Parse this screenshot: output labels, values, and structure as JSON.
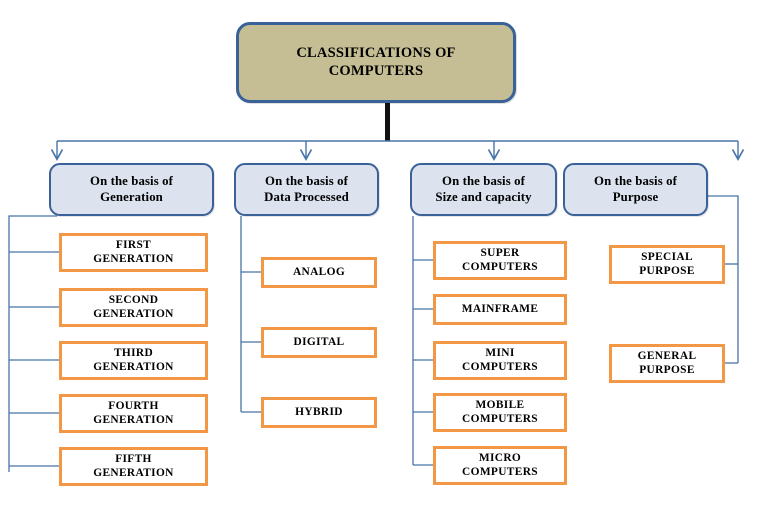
{
  "diagram": {
    "title": "CLASSIFICATIONS OF\nCOMPUTERS",
    "colors": {
      "root_fill": "#C5BE94",
      "branch_fill": "#DCE3EF",
      "leaf_fill": "#FFFFFF",
      "blue_border": "#3A6198",
      "orange_border": "#F19745",
      "connector_blue": "#4874A8",
      "trunk_black": "#111111"
    },
    "branches": [
      {
        "id": "generation",
        "label": "On the basis of\nGeneration",
        "leaves": [
          {
            "label": "FIRST\nGENERATION"
          },
          {
            "label": "SECOND\nGENERATION"
          },
          {
            "label": "THIRD\nGENERATION"
          },
          {
            "label": "FOURTH\nGENERATION"
          },
          {
            "label": "FIFTH\nGENERATION"
          }
        ]
      },
      {
        "id": "data-processed",
        "label": "On the basis of\nData Processed",
        "leaves": [
          {
            "label": "ANALOG"
          },
          {
            "label": "DIGITAL"
          },
          {
            "label": "HYBRID"
          }
        ]
      },
      {
        "id": "size-and-capacity",
        "label": "On the basis of\nSize and capacity",
        "leaves": [
          {
            "label": "SUPER\nCOMPUTERS"
          },
          {
            "label": "MAINFRAME"
          },
          {
            "label": "MINI\nCOMPUTERS"
          },
          {
            "label": "MOBILE\nCOMPUTERS"
          },
          {
            "label": "MICRO\nCOMPUTERS"
          }
        ]
      },
      {
        "id": "purpose",
        "label": "On the basis of\nPurpose",
        "leaves": [
          {
            "label": "SPECIAL\nPURPOSE"
          },
          {
            "label": "GENERAL\nPURPOSE"
          }
        ]
      }
    ]
  }
}
